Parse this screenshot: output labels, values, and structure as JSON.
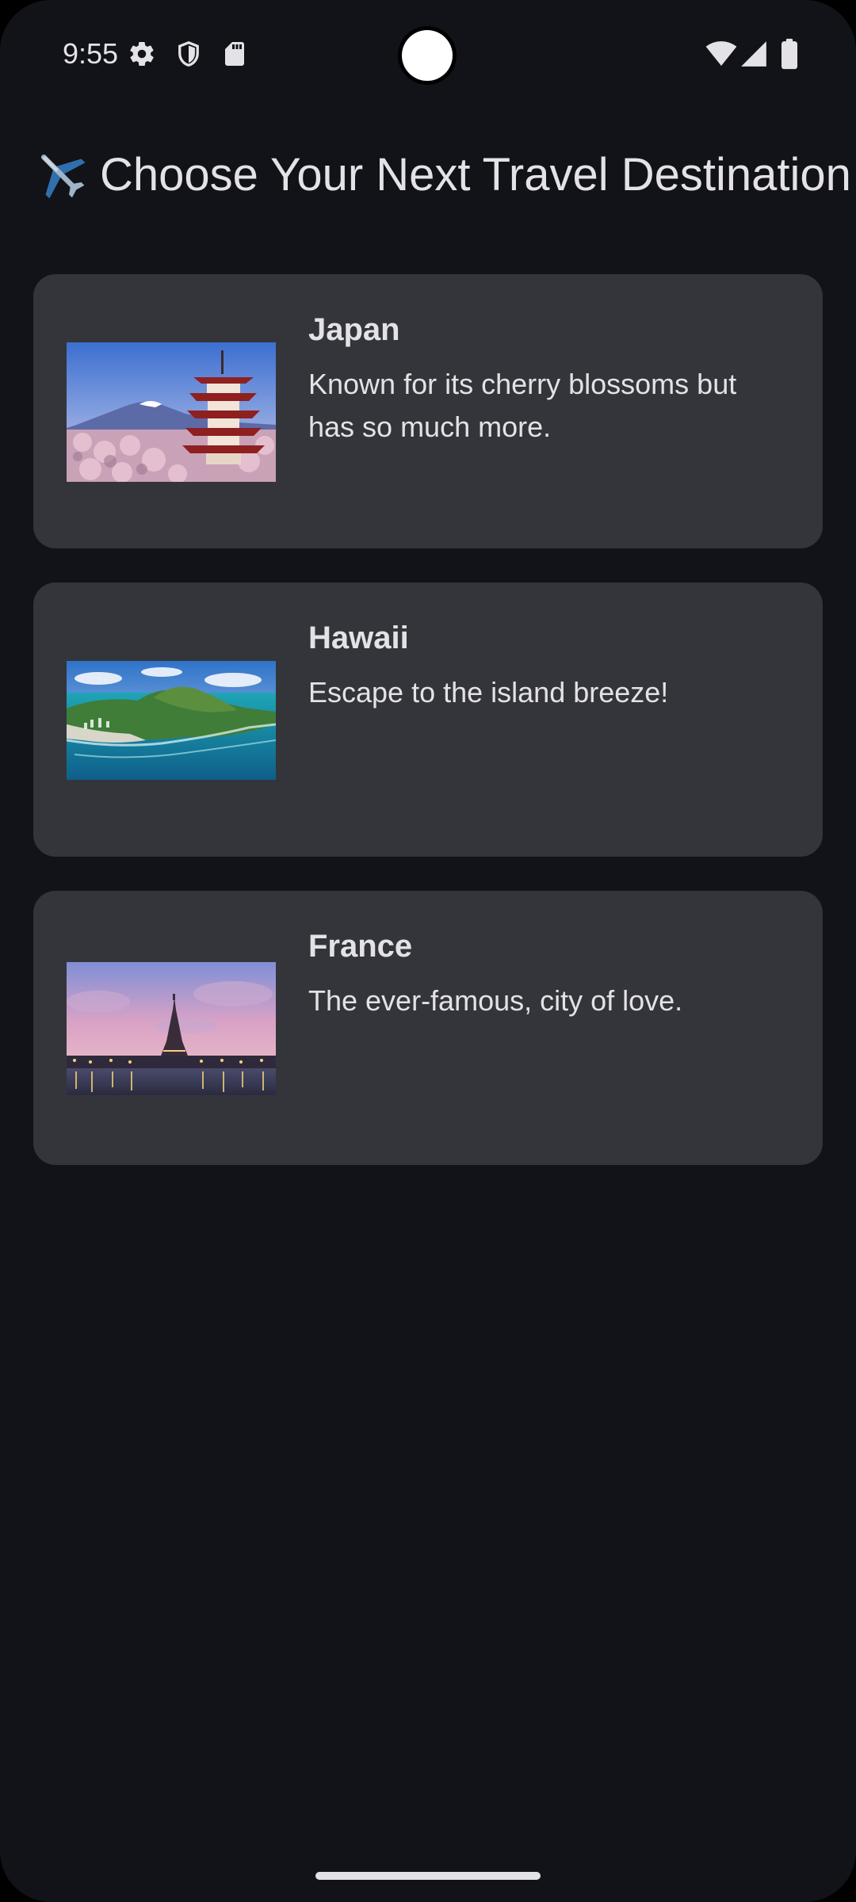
{
  "status_bar": {
    "time": "9:55",
    "left_icons": [
      "settings-gear-icon",
      "shield-icon",
      "sd-card-icon"
    ],
    "right_icons": [
      "wifi-icon",
      "cell-signal-icon",
      "battery-icon"
    ]
  },
  "header": {
    "icon": "airplane-icon",
    "title": "Choose Your Next Travel Destination"
  },
  "destinations": [
    {
      "name": "Japan",
      "description": "Known for its cherry blossoms but has so much more.",
      "image": "japan-pagoda-mount-fuji-cherry-blossoms"
    },
    {
      "name": "Hawaii",
      "description": "Escape to the island breeze!",
      "image": "hawaii-diamond-head-coast"
    },
    {
      "name": "France",
      "description": "The ever-famous, city of love.",
      "image": "france-eiffel-tower-dusk"
    }
  ],
  "colors": {
    "background": "#121318",
    "card": "#34353b",
    "text": "#e3e2e6"
  }
}
